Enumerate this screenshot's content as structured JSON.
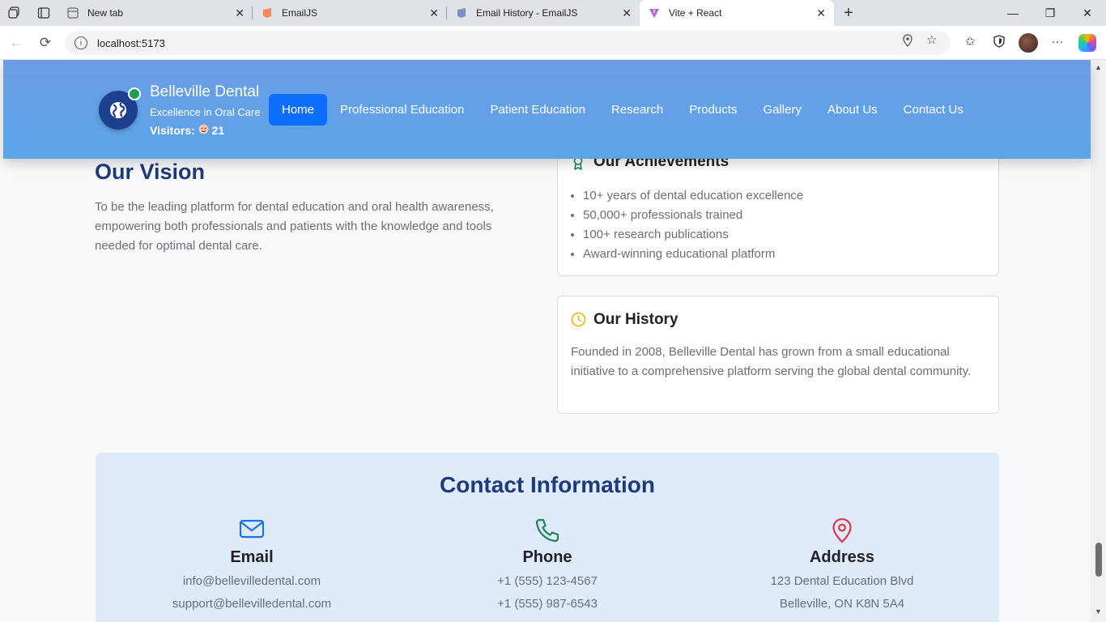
{
  "browser": {
    "tabs": [
      {
        "title": "New tab"
      },
      {
        "title": "EmailJS"
      },
      {
        "title": "Email History - EmailJS"
      },
      {
        "title": "Vite + React",
        "active": true
      }
    ],
    "url": "localhost:5173"
  },
  "header": {
    "brand_name": "Belleville Dental",
    "tagline": "Excellence in Oral Care",
    "visitors_label": "Visitors:",
    "visitors_count": "21",
    "nav": [
      "Home",
      "Professional Education",
      "Patient Education",
      "Research",
      "Products",
      "Gallery",
      "About Us",
      "Contact Us"
    ],
    "active_nav": "Home"
  },
  "vision": {
    "title": "Our Vision",
    "text": "To be the leading platform for dental education and oral health awareness, empowering both professionals and patients with the knowledge and tools needed for optimal dental care."
  },
  "achievements": {
    "title": "Our Achievements",
    "items": [
      "10+ years of dental education excellence",
      "50,000+ professionals trained",
      "100+ research publications",
      "Award-winning educational platform"
    ]
  },
  "history": {
    "title": "Our History",
    "text": "Founded in 2008, Belleville Dental has grown from a small educational initiative to a comprehensive platform serving the global dental community."
  },
  "contact": {
    "title": "Contact Information",
    "email": {
      "heading": "Email",
      "lines": [
        "info@bellevilledental.com",
        "support@bellevilledental.com"
      ]
    },
    "phone": {
      "heading": "Phone",
      "lines": [
        "+1 (555) 123-4567",
        "+1 (555) 987-6543"
      ]
    },
    "address": {
      "heading": "Address",
      "lines": [
        "123 Dental Education Blvd",
        "Belleville, ON K8N 5A4"
      ]
    }
  },
  "colors": {
    "header_gradient_top": "#6c9de6",
    "header_gradient_bottom": "#5aa4e8",
    "nav_active": "#0d6efd",
    "title_navy": "#1d3a7a",
    "email_icon": "#1a73e8",
    "phone_icon": "#198754",
    "address_icon": "#dc3545",
    "history_icon": "#f0b400",
    "achievement_icon": "#198754"
  }
}
